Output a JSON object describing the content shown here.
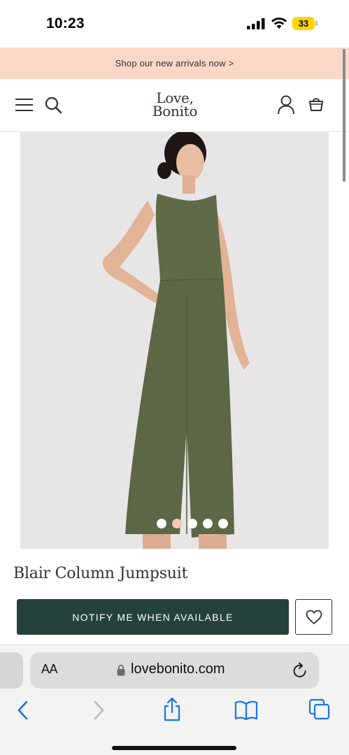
{
  "status_bar": {
    "time": "10:23",
    "battery_level": "33",
    "icons": [
      "cellular-signal-icon",
      "wifi-icon",
      "battery-icon"
    ]
  },
  "promo_banner": {
    "text": "Shop our new arrivals now >"
  },
  "header": {
    "logo_line1": "Love,",
    "logo_line2": "Bonito",
    "icons": [
      "menu-icon",
      "search-icon",
      "account-icon",
      "shopping-bag-icon"
    ]
  },
  "product": {
    "image_slides": 5,
    "active_slide": 2,
    "title": "Blair Column Jumpsuit",
    "notify_label": "NOTIFY ME WHEN AVAILABLE",
    "wishlist_icon": "heart-icon"
  },
  "browser": {
    "aa_label": "AA",
    "url": "lovebonito.com",
    "toolbar_icons": [
      "back-icon",
      "forward-icon",
      "share-icon",
      "bookmarks-icon",
      "tabs-icon"
    ]
  },
  "colors": {
    "promo_bg": "#fbd7c8",
    "button_bg": "#24413d",
    "active_dot": "#f5c6b4",
    "safari_blue": "#1a73e8",
    "battery": "#ffd60a"
  }
}
